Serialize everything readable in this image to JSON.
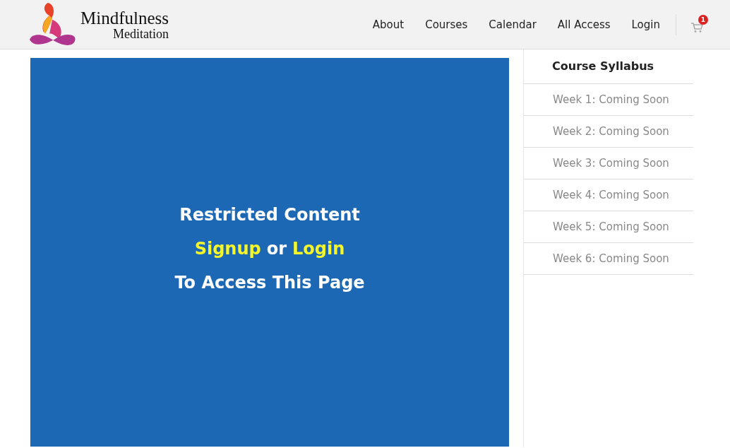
{
  "logo": {
    "line_1": "Mindfulness",
    "line_2": "Meditation"
  },
  "nav": [
    "About",
    "Courses",
    "Calendar",
    "All Access",
    "Login"
  ],
  "cart": {
    "badge": "1"
  },
  "content": {
    "heading": "Restricted Content",
    "signup": "Signup",
    "or": "or",
    "login": "Login",
    "footer": "To Access This Page"
  },
  "syllabus": {
    "title": "Course Syllabus",
    "items": [
      "Week 1: Coming Soon",
      "Week 2: Coming Soon",
      "Week 3: Coming Soon",
      "Week 4: Coming Soon",
      "Week 5: Coming Soon",
      "Week 6: Coming Soon"
    ]
  }
}
